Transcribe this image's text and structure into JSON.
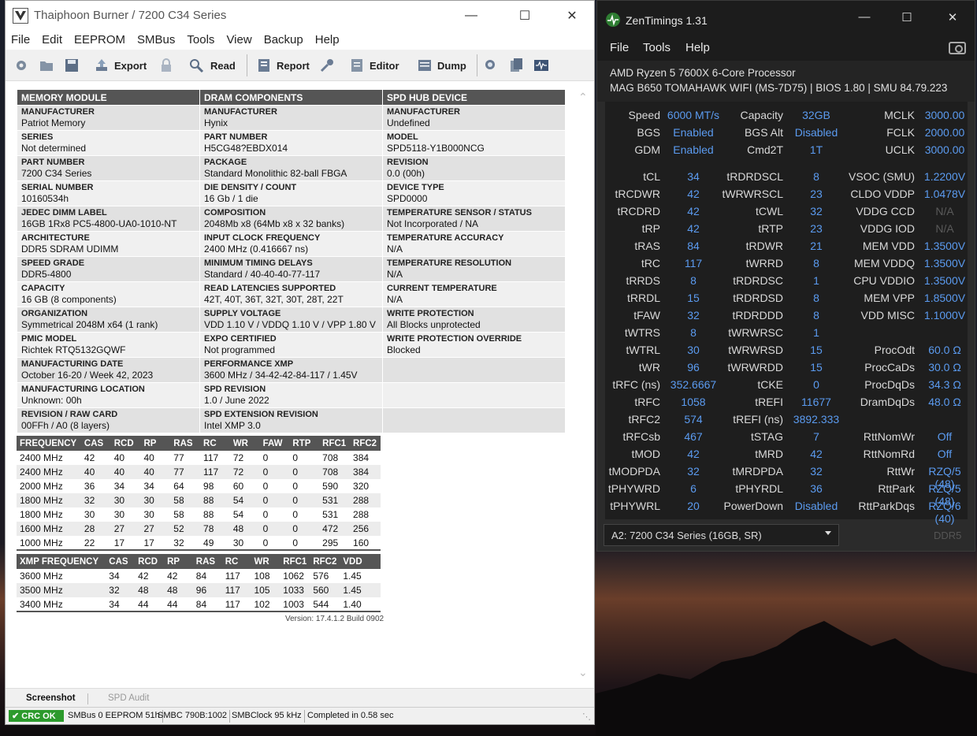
{
  "thaiphoon": {
    "title": "Thaiphoon Burner / 7200 C34 Series",
    "menu": [
      "File",
      "Edit",
      "EEPROM",
      "SMBus",
      "Tools",
      "View",
      "Backup",
      "Help"
    ],
    "toolbar": {
      "export": "Export",
      "read": "Read",
      "report": "Report",
      "editor": "Editor",
      "dump": "Dump"
    },
    "headers": [
      "MEMORY MODULE",
      "DRAM COMPONENTS",
      "SPD HUB DEVICE"
    ],
    "rows": [
      [
        [
          "MANUFACTURER",
          "Patriot Memory"
        ],
        [
          "MANUFACTURER",
          "Hynix"
        ],
        [
          "MANUFACTURER",
          "Undefined"
        ]
      ],
      [
        [
          "SERIES",
          "Not determined"
        ],
        [
          "PART NUMBER",
          "H5CG48?EBDX014"
        ],
        [
          "MODEL",
          "SPD5118-Y1B000NCG"
        ]
      ],
      [
        [
          "PART NUMBER",
          "7200 C34 Series"
        ],
        [
          "PACKAGE",
          "Standard Monolithic 82-ball FBGA"
        ],
        [
          "REVISION",
          "0.0 (00h)"
        ]
      ],
      [
        [
          "SERIAL NUMBER",
          "10160534h"
        ],
        [
          "DIE DENSITY / COUNT",
          "16 Gb / 1 die"
        ],
        [
          "DEVICE TYPE",
          "SPD0000"
        ]
      ],
      [
        [
          "JEDEC DIMM LABEL",
          "16GB 1Rx8 PC5-4800-UA0-1010-NT"
        ],
        [
          "COMPOSITION",
          "2048Mb x8 (64Mb x8 x 32 banks)"
        ],
        [
          "TEMPERATURE SENSOR / STATUS",
          "Not Incorporated / NA"
        ]
      ],
      [
        [
          "ARCHITECTURE",
          "DDR5 SDRAM UDIMM"
        ],
        [
          "INPUT CLOCK FREQUENCY",
          "2400 MHz (0.416667 ns)"
        ],
        [
          "TEMPERATURE ACCURACY",
          "N/A"
        ]
      ],
      [
        [
          "SPEED GRADE",
          "DDR5-4800"
        ],
        [
          "MINIMUM TIMING DELAYS",
          "Standard / 40-40-40-77-117"
        ],
        [
          "TEMPERATURE RESOLUTION",
          "N/A"
        ]
      ],
      [
        [
          "CAPACITY",
          "16 GB (8 components)"
        ],
        [
          "READ LATENCIES SUPPORTED",
          "42T, 40T, 36T, 32T, 30T, 28T, 22T"
        ],
        [
          "CURRENT TEMPERATURE",
          "N/A"
        ]
      ],
      [
        [
          "ORGANIZATION",
          "Symmetrical 2048M x64 (1 rank)"
        ],
        [
          "SUPPLY VOLTAGE",
          "VDD 1.10 V / VDDQ 1.10 V / VPP 1.80 V"
        ],
        [
          "WRITE PROTECTION",
          "All Blocks unprotected"
        ]
      ],
      [
        [
          "PMIC MODEL",
          "Richtek RTQ5132GQWF"
        ],
        [
          "EXPO CERTIFIED",
          "Not programmed"
        ],
        [
          "WRITE PROTECTION OVERRIDE",
          "Blocked"
        ]
      ],
      [
        [
          "MANUFACTURING DATE",
          "October 16-20 / Week 42, 2023"
        ],
        [
          "PERFORMANCE XMP",
          "3600 MHz / 34-42-42-84-117 / 1.45V"
        ],
        [
          "",
          ""
        ]
      ],
      [
        [
          "MANUFACTURING LOCATION",
          "Unknown: 00h"
        ],
        [
          "SPD REVISION",
          "1.0 / June 2022"
        ],
        [
          "",
          ""
        ]
      ],
      [
        [
          "REVISION / RAW CARD",
          "00FFh / A0 (8 layers)"
        ],
        [
          "SPD EXTENSION REVISION",
          "Intel XMP 3.0"
        ],
        [
          "",
          ""
        ]
      ]
    ],
    "freq_table": {
      "headers": [
        "FREQUENCY",
        "CAS",
        "RCD",
        "RP",
        "RAS",
        "RC",
        "WR",
        "FAW",
        "RTP",
        "RFC1",
        "RFC2"
      ],
      "rows": [
        [
          "2400 MHz",
          "42",
          "40",
          "40",
          "77",
          "117",
          "72",
          "0",
          "0",
          "708",
          "384"
        ],
        [
          "2400 MHz",
          "40",
          "40",
          "40",
          "77",
          "117",
          "72",
          "0",
          "0",
          "708",
          "384"
        ],
        [
          "2000 MHz",
          "36",
          "34",
          "34",
          "64",
          "98",
          "60",
          "0",
          "0",
          "590",
          "320"
        ],
        [
          "1800 MHz",
          "32",
          "30",
          "30",
          "58",
          "88",
          "54",
          "0",
          "0",
          "531",
          "288"
        ],
        [
          "1800 MHz",
          "30",
          "30",
          "30",
          "58",
          "88",
          "54",
          "0",
          "0",
          "531",
          "288"
        ],
        [
          "1600 MHz",
          "28",
          "27",
          "27",
          "52",
          "78",
          "48",
          "0",
          "0",
          "472",
          "256"
        ],
        [
          "1000 MHz",
          "22",
          "17",
          "17",
          "32",
          "49",
          "30",
          "0",
          "0",
          "295",
          "160"
        ]
      ]
    },
    "xmp_table": {
      "headers": [
        "XMP FREQUENCY",
        "CAS",
        "RCD",
        "RP",
        "RAS",
        "RC",
        "WR",
        "RFC1",
        "RFC2",
        "VDD"
      ],
      "rows": [
        [
          "3600 MHz",
          "34",
          "42",
          "42",
          "84",
          "117",
          "108",
          "1062",
          "576",
          "1.45"
        ],
        [
          "3500 MHz",
          "32",
          "48",
          "48",
          "96",
          "117",
          "105",
          "1033",
          "560",
          "1.45"
        ],
        [
          "3400 MHz",
          "34",
          "44",
          "44",
          "84",
          "117",
          "102",
          "1003",
          "544",
          "1.40"
        ]
      ]
    },
    "version": "Version: 17.4.1.2 Build 0902",
    "tabs": {
      "screenshot": "Screenshot",
      "audit": "SPD Audit"
    },
    "status": {
      "crc": "CRC OK",
      "smbus": "SMBus 0 EEPROM 51h",
      "smbc": "SMBC 790B:1002",
      "clock": "SMBClock 95 kHz",
      "done": "Completed in 0.58 sec"
    }
  },
  "zentimings": {
    "title": "ZenTimings 1.31",
    "menu": [
      "File",
      "Tools",
      "Help"
    ],
    "cpu": "AMD Ryzen 5 7600X 6-Core Processor",
    "board": "MAG B650 TOMAHAWK WIFI (MS-7D75) | BIOS 1.80 | SMU 84.79.223",
    "grid": [
      [
        [
          "Speed",
          "6000 MT/s"
        ],
        [
          "Capacity",
          "32GB"
        ],
        [
          "MCLK",
          "3000.00"
        ]
      ],
      [
        [
          "BGS",
          "Enabled"
        ],
        [
          "BGS Alt",
          "Disabled"
        ],
        [
          "FCLK",
          "2000.00"
        ]
      ],
      [
        [
          "GDM",
          "Enabled"
        ],
        [
          "Cmd2T",
          "1T"
        ],
        [
          "UCLK",
          "3000.00"
        ]
      ],
      [
        [
          "tCL",
          "34"
        ],
        [
          "tRDRDSCL",
          "8"
        ],
        [
          "VSOC (SMU)",
          "1.2200V"
        ]
      ],
      [
        [
          "tRCDWR",
          "42"
        ],
        [
          "tWRWRSCL",
          "23"
        ],
        [
          "CLDO VDDP",
          "1.0478V"
        ]
      ],
      [
        [
          "tRCDRD",
          "42"
        ],
        [
          "tCWL",
          "32"
        ],
        [
          "VDDG CCD",
          "N/A"
        ]
      ],
      [
        [
          "tRP",
          "42"
        ],
        [
          "tRTP",
          "23"
        ],
        [
          "VDDG IOD",
          "N/A"
        ]
      ],
      [
        [
          "tRAS",
          "84"
        ],
        [
          "tRDWR",
          "21"
        ],
        [
          "MEM VDD",
          "1.3500V"
        ]
      ],
      [
        [
          "tRC",
          "117"
        ],
        [
          "tWRRD",
          "8"
        ],
        [
          "MEM VDDQ",
          "1.3500V"
        ]
      ],
      [
        [
          "tRRDS",
          "8"
        ],
        [
          "tRDRDSC",
          "1"
        ],
        [
          "CPU VDDIO",
          "1.3500V"
        ]
      ],
      [
        [
          "tRRDL",
          "15"
        ],
        [
          "tRDRDSD",
          "8"
        ],
        [
          "MEM VPP",
          "1.8500V"
        ]
      ],
      [
        [
          "tFAW",
          "32"
        ],
        [
          "tRDRDDD",
          "8"
        ],
        [
          "VDD MISC",
          "1.1000V"
        ]
      ],
      [
        [
          "tWTRS",
          "8"
        ],
        [
          "tWRWRSC",
          "1"
        ],
        [
          "",
          ""
        ]
      ],
      [
        [
          "tWTRL",
          "30"
        ],
        [
          "tWRWRSD",
          "15"
        ],
        [
          "ProcOdt",
          "60.0 Ω"
        ]
      ],
      [
        [
          "tWR",
          "96"
        ],
        [
          "tWRWRDD",
          "15"
        ],
        [
          "ProcCaDs",
          "30.0 Ω"
        ]
      ],
      [
        [
          "tRFC (ns)",
          "352.6667"
        ],
        [
          "tCKE",
          "0"
        ],
        [
          "ProcDqDs",
          "34.3 Ω"
        ]
      ],
      [
        [
          "tRFC",
          "1058"
        ],
        [
          "tREFI",
          "11677"
        ],
        [
          "DramDqDs",
          "48.0 Ω"
        ]
      ],
      [
        [
          "tRFC2",
          "574"
        ],
        [
          "tREFI (ns)",
          "3892.333"
        ],
        [
          "",
          ""
        ]
      ],
      [
        [
          "tRFCsb",
          "467"
        ],
        [
          "tSTAG",
          "7"
        ],
        [
          "RttNomWr",
          "Off"
        ]
      ],
      [
        [
          "tMOD",
          "42"
        ],
        [
          "tMRD",
          "42"
        ],
        [
          "RttNomRd",
          "Off"
        ]
      ],
      [
        [
          "tMODPDA",
          "32"
        ],
        [
          "tMRDPDA",
          "32"
        ],
        [
          "RttWr",
          "RZQ/5 (48)"
        ]
      ],
      [
        [
          "tPHYWRD",
          "6"
        ],
        [
          "tPHYRDL",
          "36"
        ],
        [
          "RttPark",
          "RZQ/5 (48)"
        ]
      ],
      [
        [
          "tPHYWRL",
          "20"
        ],
        [
          "PowerDown",
          "Disabled"
        ],
        [
          "RttParkDqs",
          "RZQ/6 (40)"
        ]
      ]
    ],
    "module_select": "A2: 7200 C34 Series (16GB, SR)",
    "ddr": "DDR5"
  }
}
